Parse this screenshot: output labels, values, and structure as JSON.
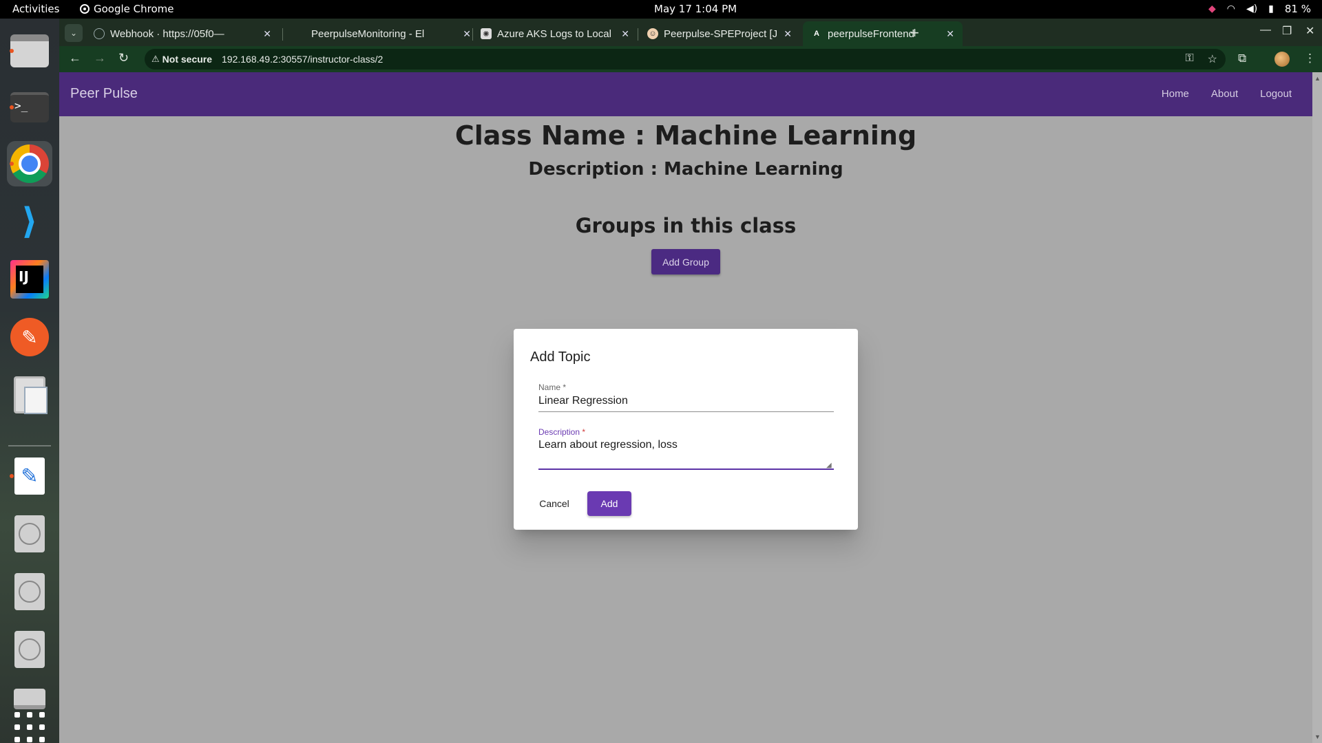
{
  "system_bar": {
    "activities": "Activities",
    "app_name": "Google Chrome",
    "clock": "May 17  1:04 PM",
    "battery": "81 %"
  },
  "browser": {
    "tabs": [
      {
        "title": "Webhook · https://05f0—",
        "active": false
      },
      {
        "title": "PeerpulseMonitoring - El",
        "active": false
      },
      {
        "title": "Azure AKS Logs to Local",
        "active": false
      },
      {
        "title": "Peerpulse-SPEProject [Je",
        "active": false
      },
      {
        "title": "peerpulseFrontend",
        "active": true
      }
    ],
    "security_label": "Not secure",
    "url": "192.168.49.2:30557/instructor-class/2"
  },
  "app": {
    "brand": "Peer Pulse",
    "nav": {
      "home": "Home",
      "about": "About",
      "logout": "Logout"
    },
    "colors": {
      "navbar": "#4a2a7a",
      "accent": "#6a3ab2"
    }
  },
  "class_page": {
    "class_name_heading": "Class Name : Machine Learning",
    "description_heading": "Description : Machine Learning",
    "groups_heading": "Groups in this class",
    "add_group_label": "Add Group"
  },
  "dialog": {
    "title": "Add Topic",
    "name_label": "Name",
    "name_value": "Linear Regression",
    "description_label": "Description",
    "description_value": "Learn about regression, loss",
    "required_marker": "*",
    "cancel_label": "Cancel",
    "add_label": "Add"
  }
}
